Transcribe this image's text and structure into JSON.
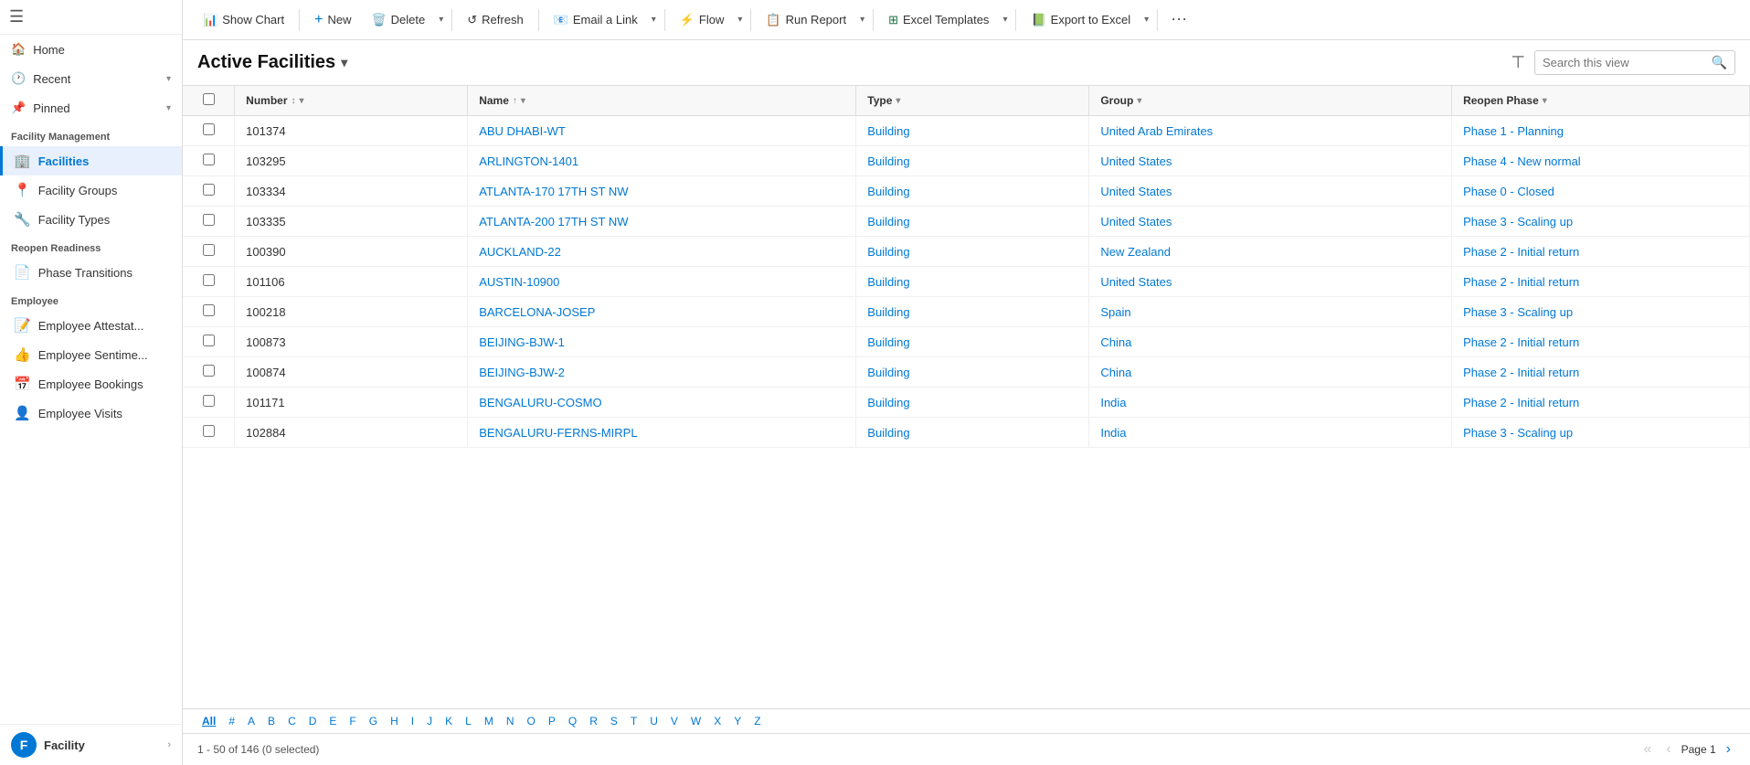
{
  "sidebar": {
    "menu_icon": "☰",
    "nav_items": [
      {
        "id": "home",
        "icon": "🏠",
        "label": "Home",
        "has_chevron": false
      },
      {
        "id": "recent",
        "icon": "🕐",
        "label": "Recent",
        "has_chevron": true
      },
      {
        "id": "pinned",
        "icon": "📌",
        "label": "Pinned",
        "has_chevron": true
      }
    ],
    "sections": [
      {
        "id": "facility-management",
        "label": "Facility Management",
        "items": [
          {
            "id": "facilities",
            "icon": "🏢",
            "label": "Facilities",
            "active": true
          },
          {
            "id": "facility-groups",
            "icon": "📍",
            "label": "Facility Groups",
            "active": false
          },
          {
            "id": "facility-types",
            "icon": "🔧",
            "label": "Facility Types",
            "active": false
          }
        ]
      },
      {
        "id": "reopen-readiness",
        "label": "Reopen Readiness",
        "items": [
          {
            "id": "phase-transitions",
            "icon": "📄",
            "label": "Phase Transitions",
            "active": false
          }
        ]
      },
      {
        "id": "employee",
        "label": "Employee",
        "items": [
          {
            "id": "employee-attest",
            "icon": "📝",
            "label": "Employee Attestat...",
            "active": false
          },
          {
            "id": "employee-sentime",
            "icon": "👍",
            "label": "Employee Sentime...",
            "active": false
          },
          {
            "id": "employee-bookings",
            "icon": "📅",
            "label": "Employee Bookings",
            "active": false
          },
          {
            "id": "employee-visits",
            "icon": "👤",
            "label": "Employee Visits",
            "active": false
          }
        ]
      }
    ],
    "footer": {
      "avatar_letter": "F",
      "label": "Facility"
    }
  },
  "toolbar": {
    "show_chart_label": "Show Chart",
    "new_label": "New",
    "delete_label": "Delete",
    "refresh_label": "Refresh",
    "email_link_label": "Email a Link",
    "flow_label": "Flow",
    "run_report_label": "Run Report",
    "excel_templates_label": "Excel Templates",
    "export_excel_label": "Export to Excel"
  },
  "view": {
    "title": "Active Facilities",
    "search_placeholder": "Search this view"
  },
  "table": {
    "columns": [
      {
        "id": "check",
        "label": ""
      },
      {
        "id": "number",
        "label": "Number",
        "sortable": true,
        "sort_dir": ""
      },
      {
        "id": "name",
        "label": "Name",
        "sortable": true,
        "sort_dir": "asc"
      },
      {
        "id": "type",
        "label": "Type",
        "sortable": true,
        "sort_dir": ""
      },
      {
        "id": "group",
        "label": "Group",
        "sortable": true,
        "sort_dir": ""
      },
      {
        "id": "reopen_phase",
        "label": "Reopen Phase",
        "sortable": true,
        "sort_dir": ""
      }
    ],
    "rows": [
      {
        "number": "101374",
        "name": "ABU DHABI-WT",
        "type": "Building",
        "group": "United Arab Emirates",
        "reopen_phase": "Phase 1 - Planning"
      },
      {
        "number": "103295",
        "name": "ARLINGTON-1401",
        "type": "Building",
        "group": "United States",
        "reopen_phase": "Phase 4 - New normal"
      },
      {
        "number": "103334",
        "name": "ATLANTA-170 17TH ST NW",
        "type": "Building",
        "group": "United States",
        "reopen_phase": "Phase 0 - Closed"
      },
      {
        "number": "103335",
        "name": "ATLANTA-200 17TH ST NW",
        "type": "Building",
        "group": "United States",
        "reopen_phase": "Phase 3 - Scaling up"
      },
      {
        "number": "100390",
        "name": "AUCKLAND-22",
        "type": "Building",
        "group": "New Zealand",
        "reopen_phase": "Phase 2 - Initial return"
      },
      {
        "number": "101106",
        "name": "AUSTIN-10900",
        "type": "Building",
        "group": "United States",
        "reopen_phase": "Phase 2 - Initial return"
      },
      {
        "number": "100218",
        "name": "BARCELONA-JOSEP",
        "type": "Building",
        "group": "Spain",
        "reopen_phase": "Phase 3 - Scaling up"
      },
      {
        "number": "100873",
        "name": "BEIJING-BJW-1",
        "type": "Building",
        "group": "China",
        "reopen_phase": "Phase 2 - Initial return"
      },
      {
        "number": "100874",
        "name": "BEIJING-BJW-2",
        "type": "Building",
        "group": "China",
        "reopen_phase": "Phase 2 - Initial return"
      },
      {
        "number": "101171",
        "name": "BENGALURU-COSMO",
        "type": "Building",
        "group": "India",
        "reopen_phase": "Phase 2 - Initial return"
      },
      {
        "number": "102884",
        "name": "BENGALURU-FERNS-MIRPL",
        "type": "Building",
        "group": "India",
        "reopen_phase": "Phase 3 - Scaling up"
      }
    ]
  },
  "alpha_bar": {
    "items": [
      "All",
      "#",
      "A",
      "B",
      "C",
      "D",
      "E",
      "F",
      "G",
      "H",
      "I",
      "J",
      "K",
      "L",
      "M",
      "N",
      "O",
      "P",
      "Q",
      "R",
      "S",
      "T",
      "U",
      "V",
      "W",
      "X",
      "Y",
      "Z"
    ],
    "active": "All"
  },
  "footer": {
    "count_label": "1 - 50 of 146 (0 selected)",
    "page_label": "Page 1"
  }
}
